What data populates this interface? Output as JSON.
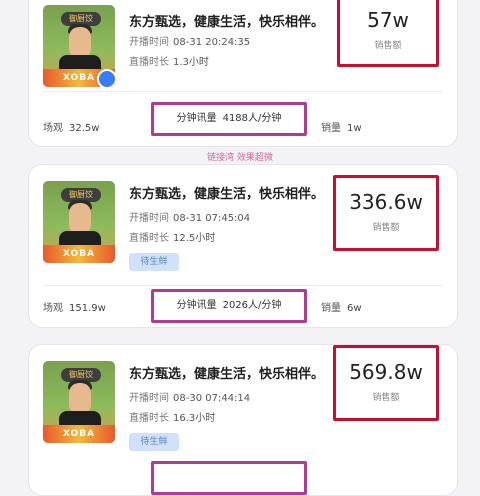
{
  "cards": [
    {
      "title": "东方甄选，健康生活，快乐相伴。",
      "start_label": "开播时间",
      "start_value": "08-31 20:24:35",
      "duration_label": "直播时长",
      "duration_value": "1.3小时",
      "tag": "",
      "gmv_value": "57w",
      "gmv_label": "销售额",
      "views_label": "场观",
      "views_value": "32.5w",
      "rate_label": "分钟讯量",
      "rate_value": "4188人/分钟",
      "sales_label": "销量",
      "sales_value": "1w"
    },
    {
      "title": "东方甄选，健康生活，快乐相伴。",
      "start_label": "开播时间",
      "start_value": "08-31 07:45:04",
      "duration_label": "直播时长",
      "duration_value": "12.5小时",
      "tag": "待生鲜",
      "gmv_value": "336.6w",
      "gmv_label": "销售额",
      "views_label": "场观",
      "views_value": "151.9w",
      "rate_label": "分钟讯量",
      "rate_value": "2026人/分钟",
      "sales_label": "销量",
      "sales_value": "6w"
    },
    {
      "title": "东方甄选，健康生活，快乐相伴。",
      "start_label": "开播时间",
      "start_value": "08-30 07:44:14",
      "duration_label": "直播时长",
      "duration_value": "16.3小时",
      "tag": "待生鲜",
      "gmv_value": "569.8w",
      "gmv_label": "销售额"
    }
  ],
  "caption": "链接湾 效果超微",
  "thumb": {
    "badge": "御厨饺",
    "plate": "XOBA"
  },
  "colors": {
    "gmv_border": "#c8102e",
    "rate_border": "#b23a93",
    "accent_blue": "#3a7bf6"
  }
}
